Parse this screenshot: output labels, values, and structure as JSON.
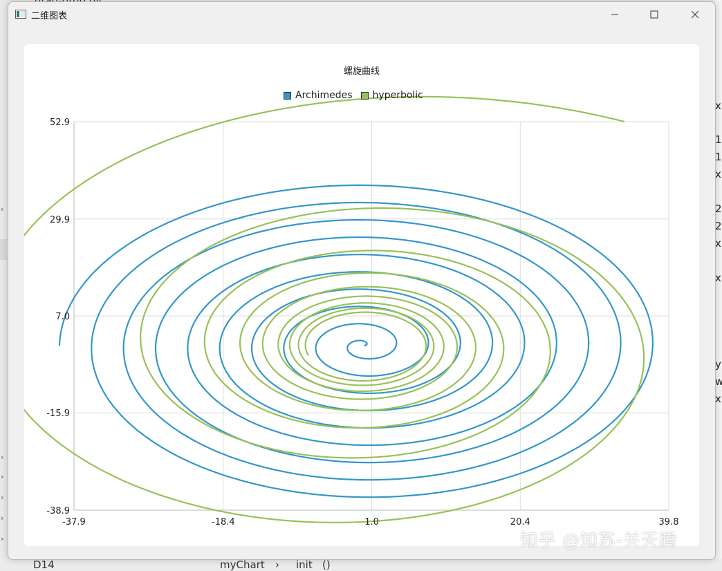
{
  "background": {
    "top_file": "drag-drop.py",
    "right_fragments": [
      "x",
      "1",
      "1",
      "x",
      "2",
      "2",
      "x",
      "x",
      "y",
      "w",
      "x"
    ],
    "bottom_left": "D14",
    "bottom_breadcrumb_1": "myChart",
    "bottom_breadcrumb_sep": "›",
    "bottom_breadcrumb_2": "init",
    "bottom_breadcrumb_3": "()"
  },
  "window": {
    "title": "二维图表",
    "icons": {
      "app": "app-window-icon",
      "minimize": "minimize-icon",
      "maximize": "maximize-icon",
      "close": "close-icon"
    }
  },
  "chart_data": {
    "type": "line",
    "title": "螺旋曲线",
    "xlabel": "",
    "ylabel": "",
    "xlim": [
      -37.9,
      39.8
    ],
    "ylim": [
      -38.9,
      52.9
    ],
    "x_ticks": [
      "-37.9",
      "-18.4",
      "1.0",
      "20.4",
      "39.8"
    ],
    "y_ticks": [
      "52.9",
      "29.9",
      "7.0",
      "-15.9",
      "-38.9"
    ],
    "grid": true,
    "legend_position": "top",
    "series": [
      {
        "name": "Archimedes",
        "color": "#3497c8",
        "curve": "archimedean spiral r = a·θ centered at (0, 0), x and y scaled independently",
        "center": [
          0.0,
          0.0
        ],
        "outer_point": [
          39.8,
          0.0
        ],
        "max_radius_x": 38.9,
        "max_radius_y": 38.9,
        "turns": 9.5
      },
      {
        "name": "hyperbolic",
        "color": "#99c158",
        "curve": "hyperbolic spiral r = a/θ centered at (0, 0)",
        "center": [
          0.0,
          0.0
        ],
        "end_point": [
          34.0,
          52.9
        ]
      }
    ]
  },
  "watermark": "知乎 @知苏-关天腾"
}
